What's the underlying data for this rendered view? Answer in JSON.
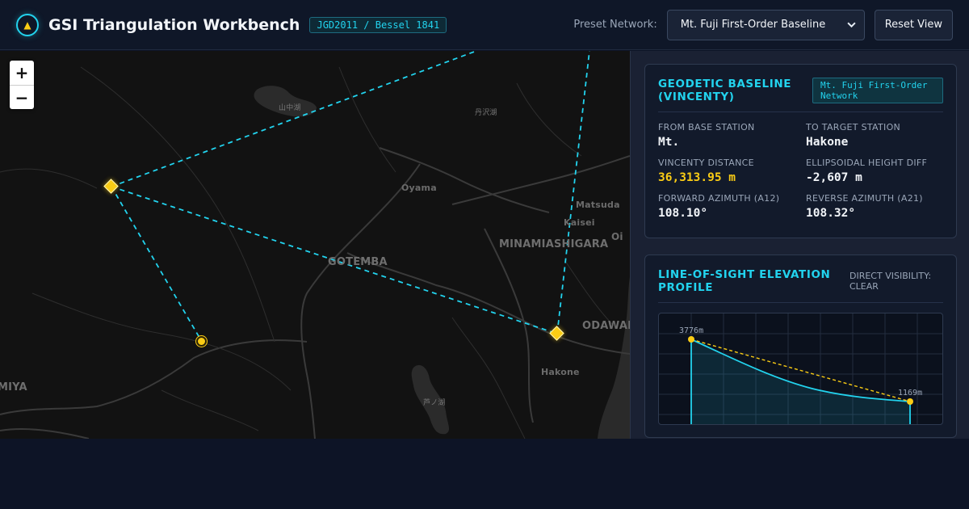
{
  "header": {
    "logo_icon": "triangle-warning-icon",
    "title": "GSI Triangulation Workbench",
    "datum_badge": "JGD2011 / Bessel 1841",
    "preset_label": "Preset Network:",
    "preset_value": "Mt. Fuji First-Order Baseline",
    "reset_label": "Reset View"
  },
  "map": {
    "zoom_in": "+",
    "zoom_out": "−",
    "labels": {
      "oyama": "Oyama",
      "matsuda": "Matsuda",
      "kaisei": "Kaisei",
      "minamiashigara": "MINAMIASHIGARA",
      "oi": "Oi",
      "gotemba": "GOTEMBA",
      "odawara": "ODAWARA",
      "hakone": "Hakone",
      "miya": "MIYA",
      "yamanakako": "山中湖",
      "tanzawako": "丹沢湖",
      "ashinoko": "芦ノ湖"
    },
    "line_color": "#22d3ee",
    "station_color": "#facc15"
  },
  "baseline": {
    "title": "Geodetic Baseline (Vincenty)",
    "network_badge": "Mt. Fuji First-Order Network",
    "from_label": "From Base Station",
    "from_value": "Mt.",
    "to_label": "To Target Station",
    "to_value": "Hakone",
    "distance_label": "Vincenty Distance",
    "distance_value": "36,313.95 m",
    "height_label": "Ellipsoidal Height Diff",
    "height_value": "-2,607 m",
    "fwd_label": "Forward Azimuth (A12)",
    "fwd_value": "108.10°",
    "rev_label": "Reverse Azimuth (A21)",
    "rev_value": "108.32°"
  },
  "profile": {
    "title": "Line-of-Sight Elevation Profile",
    "visibility": "Direct Visibility: CLEAR",
    "start_label": "3776m",
    "end_label": "1169m",
    "colors": {
      "terrain": "#22d3ee",
      "sightline": "#facc15"
    }
  }
}
